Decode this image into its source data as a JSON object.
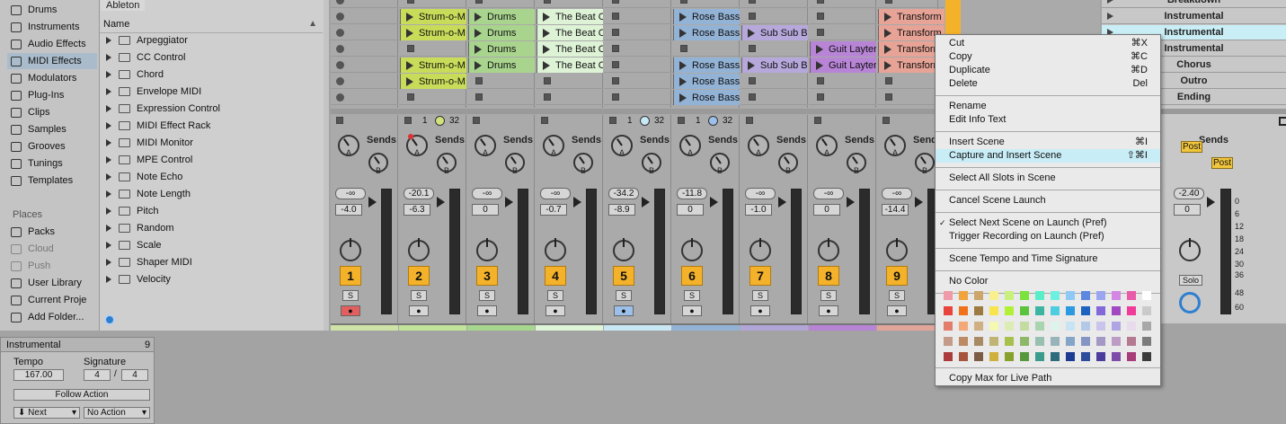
{
  "browser": {
    "categories": [
      {
        "label": "Drums",
        "icon": "grid-icon"
      },
      {
        "label": "Instruments",
        "icon": "clock-icon"
      },
      {
        "label": "Audio Effects",
        "icon": "wave-icon"
      },
      {
        "label": "MIDI Effects",
        "icon": "midi-icon",
        "selected": true
      },
      {
        "label": "Modulators",
        "icon": "modulator-icon"
      },
      {
        "label": "Plug-Ins",
        "icon": "plug-icon"
      },
      {
        "label": "Clips",
        "icon": "clip-icon"
      },
      {
        "label": "Samples",
        "icon": "sample-icon"
      },
      {
        "label": "Grooves",
        "icon": "groove-icon"
      },
      {
        "label": "Tunings",
        "icon": "tuning-icon"
      },
      {
        "label": "Templates",
        "icon": "template-icon"
      }
    ],
    "places_header": "Places",
    "places": [
      {
        "label": "Packs"
      },
      {
        "label": "Cloud",
        "dim": true
      },
      {
        "label": "Push",
        "dim": true
      },
      {
        "label": "User Library"
      },
      {
        "label": "Current Proje"
      },
      {
        "label": "Add Folder..."
      }
    ],
    "breadcrumb": "Ableton",
    "column_header": "Name",
    "items": [
      "Arpeggiator",
      "CC Control",
      "Chord",
      "Envelope MIDI",
      "Expression Control",
      "MIDI Effect Rack",
      "MIDI Monitor",
      "MPE Control",
      "Note Echo",
      "Note Length",
      "Pitch",
      "Random",
      "Scale",
      "Shaper MIDI",
      "Velocity"
    ]
  },
  "scene_view": {
    "title": "Instrumental",
    "number": "9",
    "tempo_label": "Tempo",
    "signature_label": "Signature",
    "tempo": "167.00",
    "sig_num": "4",
    "sig_sep": "/",
    "sig_den": "4",
    "follow_action": "Follow Action",
    "next": "Next",
    "no_action": "No Action"
  },
  "clips": {
    "col1": [
      "",
      "Strum-o-M",
      "Strum-o-M",
      "",
      "Strum-o-M",
      "Strum-o-M",
      ""
    ],
    "col2": [
      "",
      "Drums",
      "Drums",
      "Drums",
      "Drums",
      "",
      ""
    ],
    "col3": [
      "",
      "The Beat O",
      "The Beat O",
      "The Beat O",
      "The Beat O",
      "",
      ""
    ],
    "col5": [
      "",
      "Rose Bass",
      "Rose Bass",
      "",
      "Rose Bass",
      "Rose Bass",
      "Rose Bass"
    ],
    "col6": [
      "",
      "",
      "Sub Sub Ba",
      "",
      "Sub Sub Ba",
      "",
      ""
    ],
    "col7": [
      "",
      "",
      "",
      "Guit Layter",
      "Guit Layter",
      "",
      ""
    ],
    "col8": [
      "",
      "Transform",
      "Transform",
      "Transform",
      "Transform",
      "",
      ""
    ]
  },
  "scenes": [
    "Breakdown",
    "Instrumental",
    "Instrumental",
    "Instrumental",
    "Chorus",
    "Outro",
    "Ending"
  ],
  "midi_row": {
    "a": "1",
    "b": "32"
  },
  "mixer": {
    "sends_label": "Sends",
    "knob_a": "A",
    "knob_b": "B",
    "solo": "S",
    "master_solo": "Solo",
    "post": "Post",
    "tracks": [
      {
        "num": "1",
        "peak": "-∞",
        "vol": "-4.0",
        "color": "#cfe3a8",
        "rec": "#e35e5e"
      },
      {
        "num": "2",
        "peak": "-20.1",
        "vol": "-6.3",
        "color": "#c2e39a",
        "rec": "#d6d6d6"
      },
      {
        "num": "3",
        "peak": "-∞",
        "vol": "0",
        "color": "#a7d68f",
        "rec": "#d6d6d6"
      },
      {
        "num": "4",
        "peak": "-∞",
        "vol": "-0.7",
        "color": "#dff5d8",
        "rec": "#d6d6d6"
      },
      {
        "num": "5",
        "peak": "-34.2",
        "vol": "-8.9",
        "color": "#c8e8f5",
        "rec": "#9cc0ea"
      },
      {
        "num": "6",
        "peak": "-11.8",
        "vol": "0",
        "color": "#93b3d6",
        "rec": "#d6d6d6"
      },
      {
        "num": "7",
        "peak": "-∞",
        "vol": "-1.0",
        "color": "#b2a6d8",
        "rec": "#d6d6d6"
      },
      {
        "num": "8",
        "peak": "-∞",
        "vol": "0",
        "color": "#b884d6",
        "rec": "#d6d6d6"
      },
      {
        "num": "9",
        "peak": "-∞",
        "vol": "-14.4",
        "color": "#e2a59a",
        "rec": "#d6d6d6"
      }
    ],
    "master": {
      "peak": "-2.40",
      "vol": "0"
    },
    "scale": [
      "0",
      "6",
      "12",
      "18",
      "24",
      "30",
      "36",
      "48",
      "60"
    ]
  },
  "context_menu": {
    "items": [
      {
        "label": "Cut",
        "shortcut": "⌘X"
      },
      {
        "label": "Copy",
        "shortcut": "⌘C"
      },
      {
        "label": "Duplicate",
        "shortcut": "⌘D"
      },
      {
        "label": "Delete",
        "shortcut": "Del"
      },
      {
        "label": "Rename",
        "shortcut": ""
      },
      {
        "label": "Edit Info Text",
        "shortcut": ""
      },
      {
        "label": "Insert Scene",
        "shortcut": "⌘I"
      },
      {
        "label": "Capture and Insert Scene",
        "shortcut": "⇧⌘I",
        "highlighted": true
      },
      {
        "label": "Select All Slots in Scene",
        "shortcut": ""
      },
      {
        "label": "Cancel Scene Launch",
        "shortcut": ""
      },
      {
        "label": "Select Next Scene on Launch (Pref)",
        "shortcut": "",
        "checked": true
      },
      {
        "label": "Trigger Recording on Launch (Pref)",
        "shortcut": ""
      },
      {
        "label": "Scene Tempo and Time Signature",
        "shortcut": ""
      },
      {
        "label": "No Color",
        "shortcut": ""
      },
      {
        "label": "Copy Max for Live Path",
        "shortcut": ""
      }
    ],
    "check": "✓",
    "palette": [
      [
        "#f09aa8",
        "#f0a43c",
        "#cca66a",
        "#f8f08c",
        "#c8f07c",
        "#7ce23c",
        "#58eec8",
        "#6ef0e0",
        "#8ec8f4",
        "#5c88e0",
        "#9aa6f0",
        "#d486e4",
        "#e85ca8",
        "#ffffff"
      ],
      [
        "#e8433c",
        "#f0701c",
        "#9c7a42",
        "#f8e44c",
        "#b2f038",
        "#5cc43c",
        "#3cb6a2",
        "#4ccee0",
        "#2c9ae0",
        "#1c64c0",
        "#8268d8",
        "#a248c0",
        "#f03c98",
        "#cacaca"
      ],
      [
        "#e27c6c",
        "#f4a878",
        "#d0b082",
        "#f4f8b0",
        "#dcecb4",
        "#c4dca2",
        "#a8d4b0",
        "#dcf4ec",
        "#c8e4f4",
        "#b4c8e8",
        "#c8c4ec",
        "#b0a4e4",
        "#e8dcec",
        "#a8a8a8"
      ],
      [
        "#c49a88",
        "#bc8a64",
        "#a88a64",
        "#c0b474",
        "#a8c04c",
        "#8cb868",
        "#98c0b0",
        "#98b4ba",
        "#84a4c8",
        "#8494c4",
        "#a498c4",
        "#bc9cc4",
        "#b47a92",
        "#7c7c7c"
      ],
      [
        "#ac3c3c",
        "#a8543c",
        "#7c5c44",
        "#d0b03c",
        "#88a02c",
        "#58983c",
        "#3c9c8c",
        "#2c6c7c",
        "#1c3c94",
        "#2c4c9c",
        "#4c3c9c",
        "#7c4ca8",
        "#a83c78",
        "#3c3c3c"
      ]
    ]
  }
}
